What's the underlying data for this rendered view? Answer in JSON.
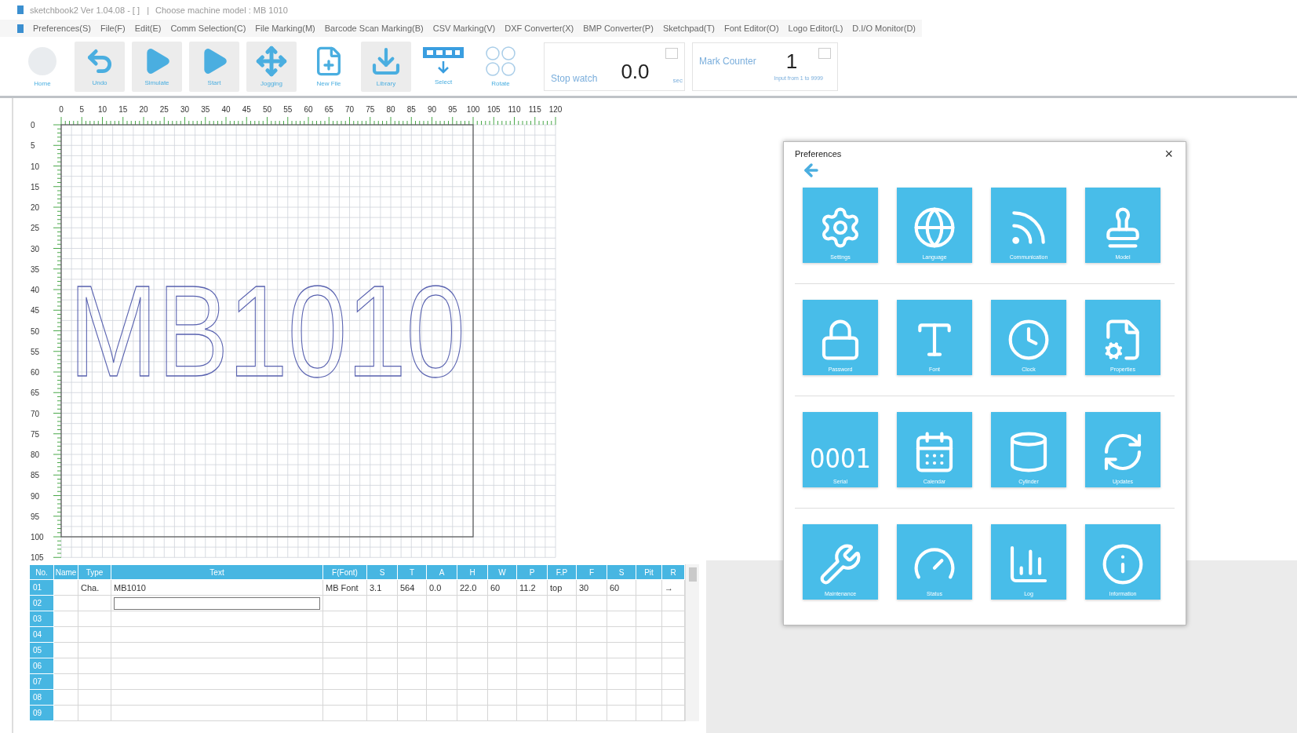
{
  "window": {
    "title": "sketchbook2 Ver 1.04.08 - [ ]   |",
    "subtitle": "Choose machine model : MB 1010"
  },
  "menu": [
    "Preferences(S)",
    "File(F)",
    "Edit(E)",
    "Comm Selection(C)",
    "File Marking(M)",
    "Barcode Scan Marking(B)",
    "CSV Marking(V)",
    "DXF Converter(X)",
    "BMP Converter(P)",
    "Sketchpad(T)",
    "Font Editor(O)",
    "Logo Editor(L)",
    "D.I/O Monitor(D)"
  ],
  "toolbar": {
    "buttons": [
      {
        "label": "Home",
        "highlighted": false
      },
      {
        "label": "Undo",
        "highlighted": true
      },
      {
        "label": "Simulate",
        "highlighted": true
      },
      {
        "label": "Start",
        "highlighted": true
      },
      {
        "label": "Jogging",
        "highlighted": true
      },
      {
        "label": "New File",
        "highlighted": false
      },
      {
        "label": "Library",
        "highlighted": true
      },
      {
        "label": "Select",
        "highlighted": false
      },
      {
        "label": "Rotate",
        "highlighted": false
      }
    ],
    "stopwatch": {
      "label": "Stop watch",
      "value": "0.0",
      "unit": "sec"
    },
    "counter": {
      "label": "Mark Counter",
      "value": "1",
      "hint": "Input from 1 to 9999"
    }
  },
  "canvas": {
    "x_ruler": [
      "0",
      "5",
      "10",
      "15",
      "20",
      "25",
      "30",
      "35",
      "40",
      "45",
      "50",
      "55",
      "60",
      "65",
      "70",
      "75",
      "80",
      "85",
      "90",
      "95",
      "100",
      "105",
      "110",
      "115",
      "120"
    ],
    "y_ruler": [
      "0",
      "5",
      "10",
      "15",
      "20",
      "25",
      "30",
      "35",
      "40",
      "45",
      "50",
      "55",
      "60",
      "65",
      "70",
      "75",
      "80",
      "85",
      "90",
      "95",
      "100",
      "105"
    ],
    "text": "MB1010"
  },
  "table": {
    "columns": [
      "No.",
      "Name",
      "Type",
      "Text",
      "F(Font)",
      "S",
      "T",
      "A",
      "H",
      "W",
      "P",
      "F.P",
      "F",
      "S",
      "Pit",
      "R"
    ],
    "rows": [
      {
        "no": "01",
        "editing": false,
        "cells": [
          null,
          "Cha.",
          "MB1010",
          "MB Font",
          "3.1",
          "564",
          "0.0",
          "22.0",
          "60",
          "11.2",
          "top",
          "30",
          "60",
          null,
          "→"
        ]
      },
      {
        "no": "02",
        "editing": true
      },
      {
        "no": "03",
        "editing": false
      },
      {
        "no": "04",
        "editing": false
      },
      {
        "no": "05",
        "editing": false
      },
      {
        "no": "06",
        "editing": false
      },
      {
        "no": "07",
        "editing": false
      },
      {
        "no": "08",
        "editing": false
      },
      {
        "no": "09",
        "editing": false
      }
    ]
  },
  "dialog": {
    "title": "Preferences",
    "close": "×",
    "rows": [
      {
        "tiles": [
          {
            "label": "Settings"
          },
          {
            "label": "Language"
          },
          {
            "label": "Communication"
          },
          {
            "label": "Model"
          }
        ]
      },
      {
        "tiles": [
          {
            "label": "Password"
          },
          {
            "label": "Font"
          },
          {
            "label": "Clock"
          },
          {
            "label": "Properties"
          }
        ]
      },
      {
        "tiles": [
          {
            "label": "Serial",
            "glyph": "0001"
          },
          {
            "label": "Calendar"
          },
          {
            "label": "Cylinder"
          },
          {
            "label": "Updates"
          }
        ]
      },
      {
        "tiles": [
          {
            "label": "Maintenance"
          },
          {
            "label": "Status"
          },
          {
            "label": "Log"
          },
          {
            "label": "Information"
          }
        ]
      }
    ]
  }
}
